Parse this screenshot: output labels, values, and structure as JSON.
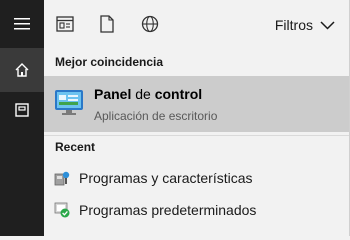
{
  "rail": {
    "items": [
      {
        "icon": "hamburger-menu-icon"
      },
      {
        "icon": "home-icon"
      },
      {
        "icon": "documents-icon"
      }
    ]
  },
  "topbar": {
    "icons": [
      "apps-icon",
      "document-icon",
      "web-globe-icon"
    ],
    "filters_label": "Filtros"
  },
  "best_match": {
    "section_label": "Mejor coincidencia",
    "title_bold_1": "Panel",
    "title_normal": " de ",
    "title_bold_2": "control",
    "subtitle": "Aplicación de escritorio",
    "icon": "control-panel-icon"
  },
  "recent": {
    "section_label": "Recent",
    "items": [
      {
        "label": "Programas y características",
        "icon": "programs-features-icon"
      },
      {
        "label": "Programas predeterminados",
        "icon": "default-programs-icon"
      }
    ]
  },
  "colors": {
    "rail_bg": "#1f1f1f",
    "panel_bg": "#f2f2f2",
    "selected_bg": "#cccccc"
  }
}
